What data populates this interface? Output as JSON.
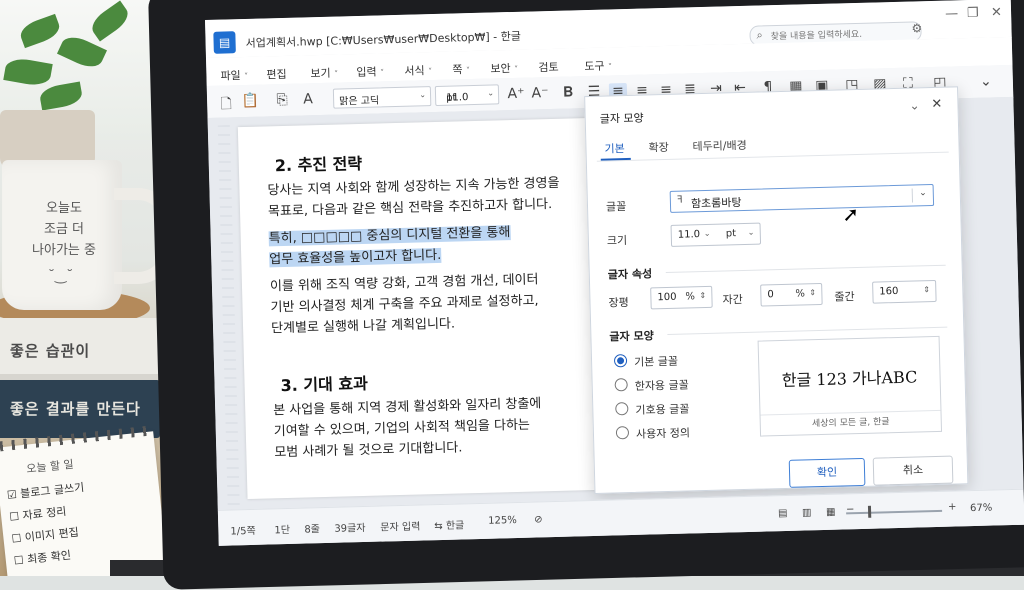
{
  "window": {
    "doc_title": "서업계획서.hwp [C:₩Users₩user₩Desktop₩] - 한글",
    "search_placeholder": "찾을 내용을 입력하세요."
  },
  "menu": [
    "파일",
    "편집",
    "보기",
    "입력",
    "서식",
    "쪽",
    "보안",
    "검토",
    "도구"
  ],
  "ribbon": {
    "font_name": "맑은 고딕",
    "font_size": "11.0",
    "font_unit": "pt"
  },
  "document": {
    "heading1": "2.  추진 전략",
    "para1": [
      "당사는 지역 사회와 함께 성장하는 지속 가능한 경영을",
      "목표로, 다음과 같은 핵심 전략을 추진하고자 합니다."
    ],
    "highlight": [
      "특히, □□□□□ 중심의 디지털 전환을 통해",
      "업무 효율성을 높이고자 합니다."
    ],
    "para2": [
      "이를 위해 조직 역량 강화, 고객 경험 개선, 데이터",
      "기반 의사결정 체계 구축을 주요 과제로 설정하고,",
      "단계별로 실행해 나갈 계획입니다."
    ],
    "heading2": "3.  기대 효과",
    "para3": [
      "본 사업을 통해 지역 경제 활성화와 일자리 창출에",
      "기여할 수 있으며, 기업의 사회적 책임을 다하는",
      "모범 사례가 될 것으로 기대합니다."
    ]
  },
  "dialog": {
    "title": "글자 모양",
    "tabs": [
      "기본",
      "확장",
      "테두리/배경"
    ],
    "font_label": "글꼴",
    "font_value": "함초롬바탕",
    "size_label": "크기",
    "size_value": "11.0",
    "size_unit": "pt",
    "attr_section": "글자 속성",
    "width_label": "장평",
    "width_value": "100",
    "width_unit": "%",
    "spacing_label": "자간",
    "spacing_value": "0",
    "spacing_unit": "%",
    "line_label": "줄간",
    "line_value": "160",
    "shape_section": "글자 모양",
    "radio_options": [
      "기본 글꼴",
      "한자용 글꼴",
      "기호용 글꼴",
      "사용자 정의"
    ],
    "preview_text": "한글 123  가나ABC",
    "preview_caption": "세상의 모든 글, 한글",
    "ok": "확인",
    "cancel": "취소"
  },
  "status": {
    "page": "1/5쪽",
    "column": "1단",
    "line": "8줄",
    "chars": "39글자",
    "mode": "문자 입력",
    "lang": "한글",
    "zoom": "125%",
    "zoom2": "67%"
  },
  "desk": {
    "mug_text": [
      "오늘도",
      "조금 더",
      "나아가는 중"
    ],
    "book1": "좋은 습관이",
    "book2": "좋은 결과를 만든다",
    "notepad_title": "오늘 할 일",
    "notepad_items": [
      "☑ 블로그 글쓰기",
      "☐ 자료 정리",
      "☐ 이미지 편집",
      "☐ 최종 확인"
    ]
  }
}
